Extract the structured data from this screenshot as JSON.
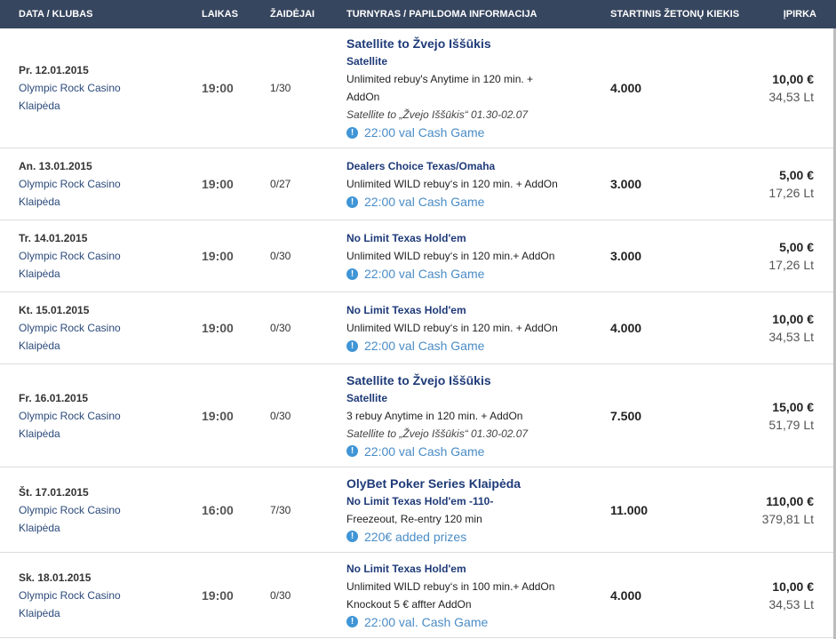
{
  "headers": {
    "date": "DATA / KLUBAS",
    "time": "LAIKAS",
    "players": "ŽAIDĖJAI",
    "tournament": "TURNYRAS / PAPILDOMA INFORMACIJA",
    "chips": "STARTINIS ŽETONŲ KIEKIS",
    "buyin": "ĮPIRKA"
  },
  "colors": {
    "header_bg": "#37465f",
    "title": "#1e3a78",
    "note": "#4a8cc6",
    "info_icon": "#3f95d6"
  },
  "note_icon": "info-icon",
  "rows": [
    {
      "date": "Pr. 12.01.2015",
      "club": "Olympic Rock Casino",
      "city": "Klaipėda",
      "time": "19:00",
      "players": "1/30",
      "info": [
        {
          "type": "h1",
          "text": "Satellite to Žvejo Iššūkis"
        },
        {
          "type": "h2",
          "text": "Satellite"
        },
        {
          "type": "t",
          "text": "Unlimited rebuy's  Anytime in 120 min. +"
        },
        {
          "type": "t",
          "text": "AddOn"
        },
        {
          "type": "it",
          "text": "Satellite to „Žvejo Iššūkis“ 01.30-02.07"
        },
        {
          "type": "note",
          "text": "22:00 val Cash Game"
        }
      ],
      "chips": "4.000",
      "eur": "10,00 €",
      "lt": "34,53 Lt",
      "height": 135
    },
    {
      "date": "An. 13.01.2015",
      "club": "Olympic Rock Casino",
      "city": "Klaipėda",
      "time": "19:00",
      "players": "0/27",
      "info": [
        {
          "type": "h2",
          "text": "Dealers Choice Texas/Omaha"
        },
        {
          "type": "t",
          "text": "Unlimited WILD rebuy‘s in 120 min. + AddOn"
        },
        {
          "type": "note",
          "text": "22:00 val Cash Game"
        }
      ],
      "chips": "3.000",
      "eur": "5,00 €",
      "lt": "17,26 Lt",
      "height": 81
    },
    {
      "date": "Tr. 14.01.2015",
      "club": "Olympic Rock Casino",
      "city": "Klaipėda",
      "time": "19:00",
      "players": "0/30",
      "info": [
        {
          "type": "h2",
          "text": "No Limit Texas Hold'em"
        },
        {
          "type": "t",
          "text": "Unlimited WILD rebuy‘s in 120 min.+ AddOn"
        },
        {
          "type": "note",
          "text": "22:00 val Cash Game"
        }
      ],
      "chips": "3.000",
      "eur": "5,00 €",
      "lt": "17,26 Lt",
      "height": 81
    },
    {
      "date": "Kt. 15.01.2015",
      "club": "Olympic Rock Casino",
      "city": "Klaipėda",
      "time": "19:00",
      "players": "0/30",
      "info": [
        {
          "type": "h2",
          "text": "No Limit Texas Hold'em"
        },
        {
          "type": "t",
          "text": "Unlimited WILD rebuy‘s in 120 min. + AddOn"
        },
        {
          "type": "note",
          "text": "22:00 val Cash Game"
        }
      ],
      "chips": "4.000",
      "eur": "10,00 €",
      "lt": "34,53 Lt",
      "height": 81
    },
    {
      "date": "Fr. 16.01.2015",
      "club": "Olympic Rock Casino",
      "city": "Klaipėda",
      "time": "19:00",
      "players": "0/30",
      "info": [
        {
          "type": "h1",
          "text": "Satellite to Žvejo Iššūkis"
        },
        {
          "type": "h2",
          "text": "Satellite"
        },
        {
          "type": "t",
          "text": "3 rebuy  Anytime in 120 min. + AddOn"
        },
        {
          "type": "it",
          "text": "Satellite to „Žvejo Iššūkis“ 01.30-02.07"
        },
        {
          "type": "note",
          "text": "22:00 val Cash Game"
        }
      ],
      "chips": "7.500",
      "eur": "15,00 €",
      "lt": "51,79 Lt",
      "height": 116
    },
    {
      "date": "Št. 17.01.2015",
      "club": "Olympic Rock Casino",
      "city": "Klaipėda",
      "time": "16:00",
      "players": "7/30",
      "info": [
        {
          "type": "h1",
          "text": "OlyBet Poker Series Klaipėda"
        },
        {
          "type": "h2",
          "text": "No Limit Texas Hold'em -110-"
        },
        {
          "type": "t",
          "text": "Freezeout, Re-entry 120 min"
        },
        {
          "type": "note",
          "text": "220€ added prizes"
        }
      ],
      "chips": "11.000",
      "eur": "110,00 €",
      "lt": "379,81 Lt",
      "height": 96
    },
    {
      "date": "Sk. 18.01.2015",
      "club": "Olympic Rock Casino",
      "city": "Klaipėda",
      "time": "19:00",
      "players": "0/30",
      "info": [
        {
          "type": "h2",
          "text": "No Limit Texas Hold'em"
        },
        {
          "type": "t",
          "text": "Unlimited WILD rebuy‘s in 100 min.+ AddOn"
        },
        {
          "type": "t",
          "text": "Knockout 5 € affter AddOn"
        },
        {
          "type": "note",
          "text": "22:00 val. Cash Game"
        }
      ],
      "chips": "4.000",
      "eur": "10,00 €",
      "lt": "34,53 Lt",
      "height": 96
    }
  ]
}
